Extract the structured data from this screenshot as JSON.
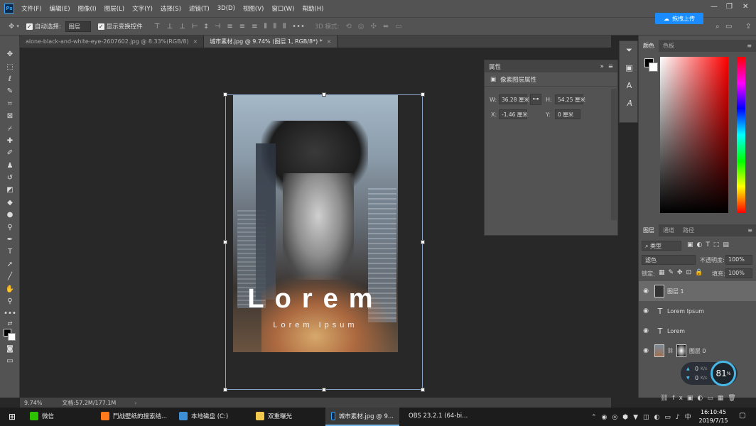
{
  "menubar": {
    "items": [
      "文件(F)",
      "编辑(E)",
      "图像(I)",
      "图层(L)",
      "文字(Y)",
      "选择(S)",
      "滤镜(T)",
      "3D(D)",
      "视图(V)",
      "窗口(W)",
      "帮助(H)"
    ],
    "upload_label": "拖拽上传"
  },
  "options": {
    "auto_select_label": "自动选择:",
    "auto_select_value": "图层",
    "show_transform_label": "显示变换控件",
    "mode_3d_label": "3D 模式:"
  },
  "tabs": [
    {
      "label": "alone-black-and-white-eye-2607602.jpg @ 8.33%(RGB/8)",
      "active": false
    },
    {
      "label": "城市素材.jpg @ 9.74% (图层 1, RGB/8*) *",
      "active": true
    }
  ],
  "canvas": {
    "title_text": "Lorem",
    "subtitle_text": "Lorem Ipsum"
  },
  "status": {
    "zoom": "9.74%",
    "doc_info": "文档:57.2M/177.1M"
  },
  "properties": {
    "tab_label": "属性",
    "section_label": "像素图层属性",
    "w_label": "W:",
    "w_value": "36.28 厘米",
    "h_label": "H:",
    "h_value": "54.25 厘米",
    "x_label": "X:",
    "x_value": "-1.46 厘米",
    "y_label": "Y:",
    "y_value": "0 厘米"
  },
  "color_panel": {
    "tabs": [
      "颜色",
      "色板"
    ]
  },
  "layers_panel": {
    "tabs": [
      "图层",
      "通道",
      "路径"
    ],
    "filter_value": "类型",
    "blend_mode": "滤色",
    "opacity_label": "不透明度:",
    "opacity_value": "100%",
    "lock_label": "锁定:",
    "fill_label": "填充:",
    "fill_value": "100%",
    "layers": [
      {
        "name": "图层 1",
        "type": "image",
        "selected": true
      },
      {
        "name": "Lorem Ipsum",
        "type": "text",
        "selected": false
      },
      {
        "name": "Lorem",
        "type": "text",
        "selected": false
      },
      {
        "name": "图层 0",
        "type": "image-mask",
        "selected": false
      }
    ]
  },
  "perf_widget": {
    "up": "0",
    "up_unit": "K/s",
    "down": "0",
    "down_unit": "K/s",
    "percent": "81",
    "percent_unit": "%"
  },
  "taskbar": {
    "items": [
      {
        "label": "微信",
        "color": "#2dc100",
        "active": false
      },
      {
        "label": "鬥战壁纸的搜索结...",
        "color": "#ff7a1a",
        "active": false
      },
      {
        "label": "本地磁盘 (C:)",
        "color": "#3d8fd6",
        "active": false
      },
      {
        "label": "双重曝光",
        "color": "#f2c94c",
        "active": false
      },
      {
        "label": "城市素材.jpg @ 9...",
        "color": "#31a8ff",
        "active": true
      },
      {
        "label": "OBS 23.2.1 (64-bi...",
        "color": "#666666",
        "active": false
      }
    ],
    "time": "16:10:45",
    "date": "2019/7/15"
  }
}
